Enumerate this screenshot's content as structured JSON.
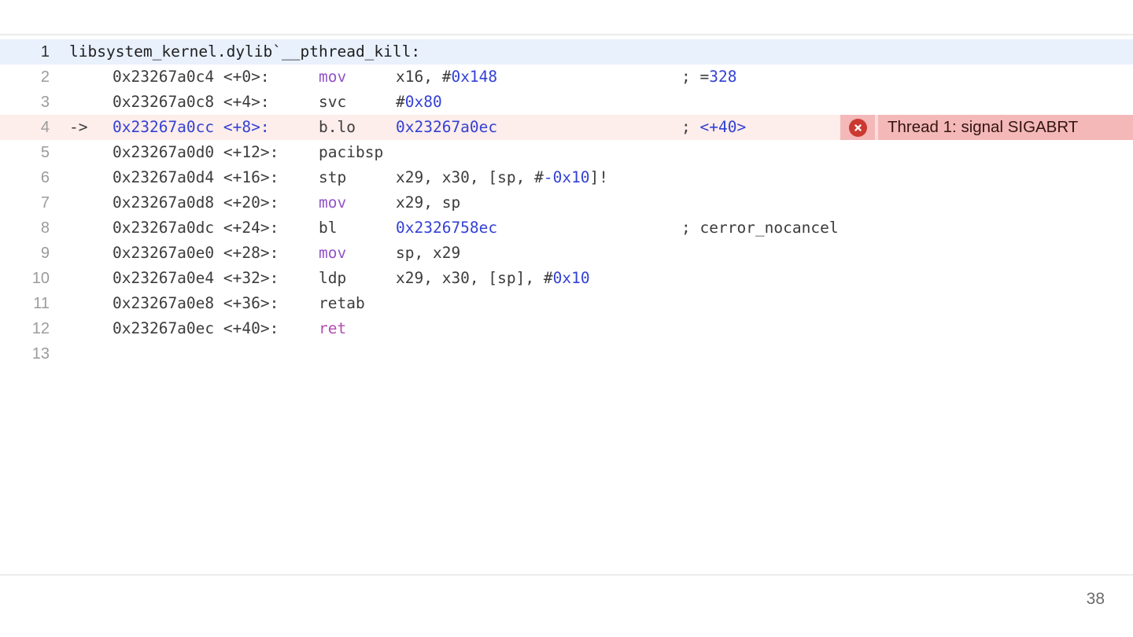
{
  "meta": {
    "page_number": "38"
  },
  "error_banner": {
    "icon": "error-circle-x-icon",
    "text": "Thread 1: signal SIGABRT"
  },
  "disassembly": {
    "rows": [
      {
        "line": "1",
        "kind": "header",
        "highlight": "header",
        "text": "libsystem_kernel.dylib`__pthread_kill:"
      },
      {
        "line": "2",
        "address": [
          {
            "t": "0x23267a0c4 <+0>:",
            "c": "plain"
          }
        ],
        "mnemonic": [
          {
            "t": "mov",
            "c": "keyword"
          }
        ],
        "operands": [
          {
            "t": "x16, #",
            "c": "plain"
          },
          {
            "t": "0x148",
            "c": "number"
          }
        ],
        "comment": [
          {
            "t": "; =",
            "c": "plain"
          },
          {
            "t": "328",
            "c": "number"
          }
        ]
      },
      {
        "line": "3",
        "address": [
          {
            "t": "0x23267a0c8 <+4>:",
            "c": "plain"
          }
        ],
        "mnemonic": [
          {
            "t": "svc",
            "c": "plain"
          }
        ],
        "operands": [
          {
            "t": "#",
            "c": "plain"
          },
          {
            "t": "0x80",
            "c": "number"
          }
        ]
      },
      {
        "line": "4",
        "marker": "->",
        "highlight": "current",
        "banner": true,
        "address": [
          {
            "t": "0x23267a0cc <+8>:",
            "c": "number"
          }
        ],
        "mnemonic": [
          {
            "t": "b.lo",
            "c": "plain"
          }
        ],
        "operands": [
          {
            "t": "0x23267a0ec",
            "c": "number"
          }
        ],
        "comment": [
          {
            "t": "; ",
            "c": "plain"
          },
          {
            "t": "<+40>",
            "c": "number"
          }
        ]
      },
      {
        "line": "5",
        "address": [
          {
            "t": "0x23267a0d0 <+12>:",
            "c": "plain"
          }
        ],
        "mnemonic": [
          {
            "t": "pacibsp",
            "c": "plain"
          }
        ]
      },
      {
        "line": "6",
        "address": [
          {
            "t": "0x23267a0d4 <+16>:",
            "c": "plain"
          }
        ],
        "mnemonic": [
          {
            "t": "stp",
            "c": "plain"
          }
        ],
        "operands": [
          {
            "t": "x29, x30, [sp, #",
            "c": "plain"
          },
          {
            "t": "-0x10",
            "c": "number"
          },
          {
            "t": "]!",
            "c": "plain"
          }
        ]
      },
      {
        "line": "7",
        "address": [
          {
            "t": "0x23267a0d8 <+20>:",
            "c": "plain"
          }
        ],
        "mnemonic": [
          {
            "t": "mov",
            "c": "keyword"
          }
        ],
        "operands": [
          {
            "t": "x29, sp",
            "c": "plain"
          }
        ]
      },
      {
        "line": "8",
        "address": [
          {
            "t": "0x23267a0dc <+24>:",
            "c": "plain"
          }
        ],
        "mnemonic": [
          {
            "t": "bl",
            "c": "plain"
          }
        ],
        "operands": [
          {
            "t": "0x2326758ec",
            "c": "number"
          }
        ],
        "comment": [
          {
            "t": "; cerror_nocancel",
            "c": "plain"
          }
        ]
      },
      {
        "line": "9",
        "address": [
          {
            "t": "0x23267a0e0 <+28>:",
            "c": "plain"
          }
        ],
        "mnemonic": [
          {
            "t": "mov",
            "c": "keyword"
          }
        ],
        "operands": [
          {
            "t": "sp, x29",
            "c": "plain"
          }
        ]
      },
      {
        "line": "10",
        "address": [
          {
            "t": "0x23267a0e4 <+32>:",
            "c": "plain"
          }
        ],
        "mnemonic": [
          {
            "t": "ldp",
            "c": "plain"
          }
        ],
        "operands": [
          {
            "t": "x29, x30, [sp], #",
            "c": "plain"
          },
          {
            "t": "0x10",
            "c": "number"
          }
        ]
      },
      {
        "line": "11",
        "address": [
          {
            "t": "0x23267a0e8 <+36>:",
            "c": "plain"
          }
        ],
        "mnemonic": [
          {
            "t": "retab",
            "c": "plain"
          }
        ]
      },
      {
        "line": "12",
        "address": [
          {
            "t": "0x23267a0ec <+40>:",
            "c": "plain"
          }
        ],
        "mnemonic": [
          {
            "t": "ret",
            "c": "ret"
          }
        ]
      },
      {
        "line": "13"
      }
    ]
  },
  "colors": {
    "plain": "#3c3c3e",
    "number": "#3341d4",
    "keyword": "#9254c7",
    "ret": "#b14cb0",
    "line_number": "#9b9b9b",
    "header_line_number": "#2c2c2e",
    "header_text": "#1f1f21",
    "row_highlight_header": "#e9f1fc",
    "row_highlight_current": "#fdedeb",
    "banner_bg": "#f4b8b8",
    "banner_divider": "#fbdfdf",
    "banner_text": "#331512",
    "banner_icon_bg": "#cb3a30",
    "hairline": "#ececec",
    "page_number_color": "#6b6b6b"
  }
}
